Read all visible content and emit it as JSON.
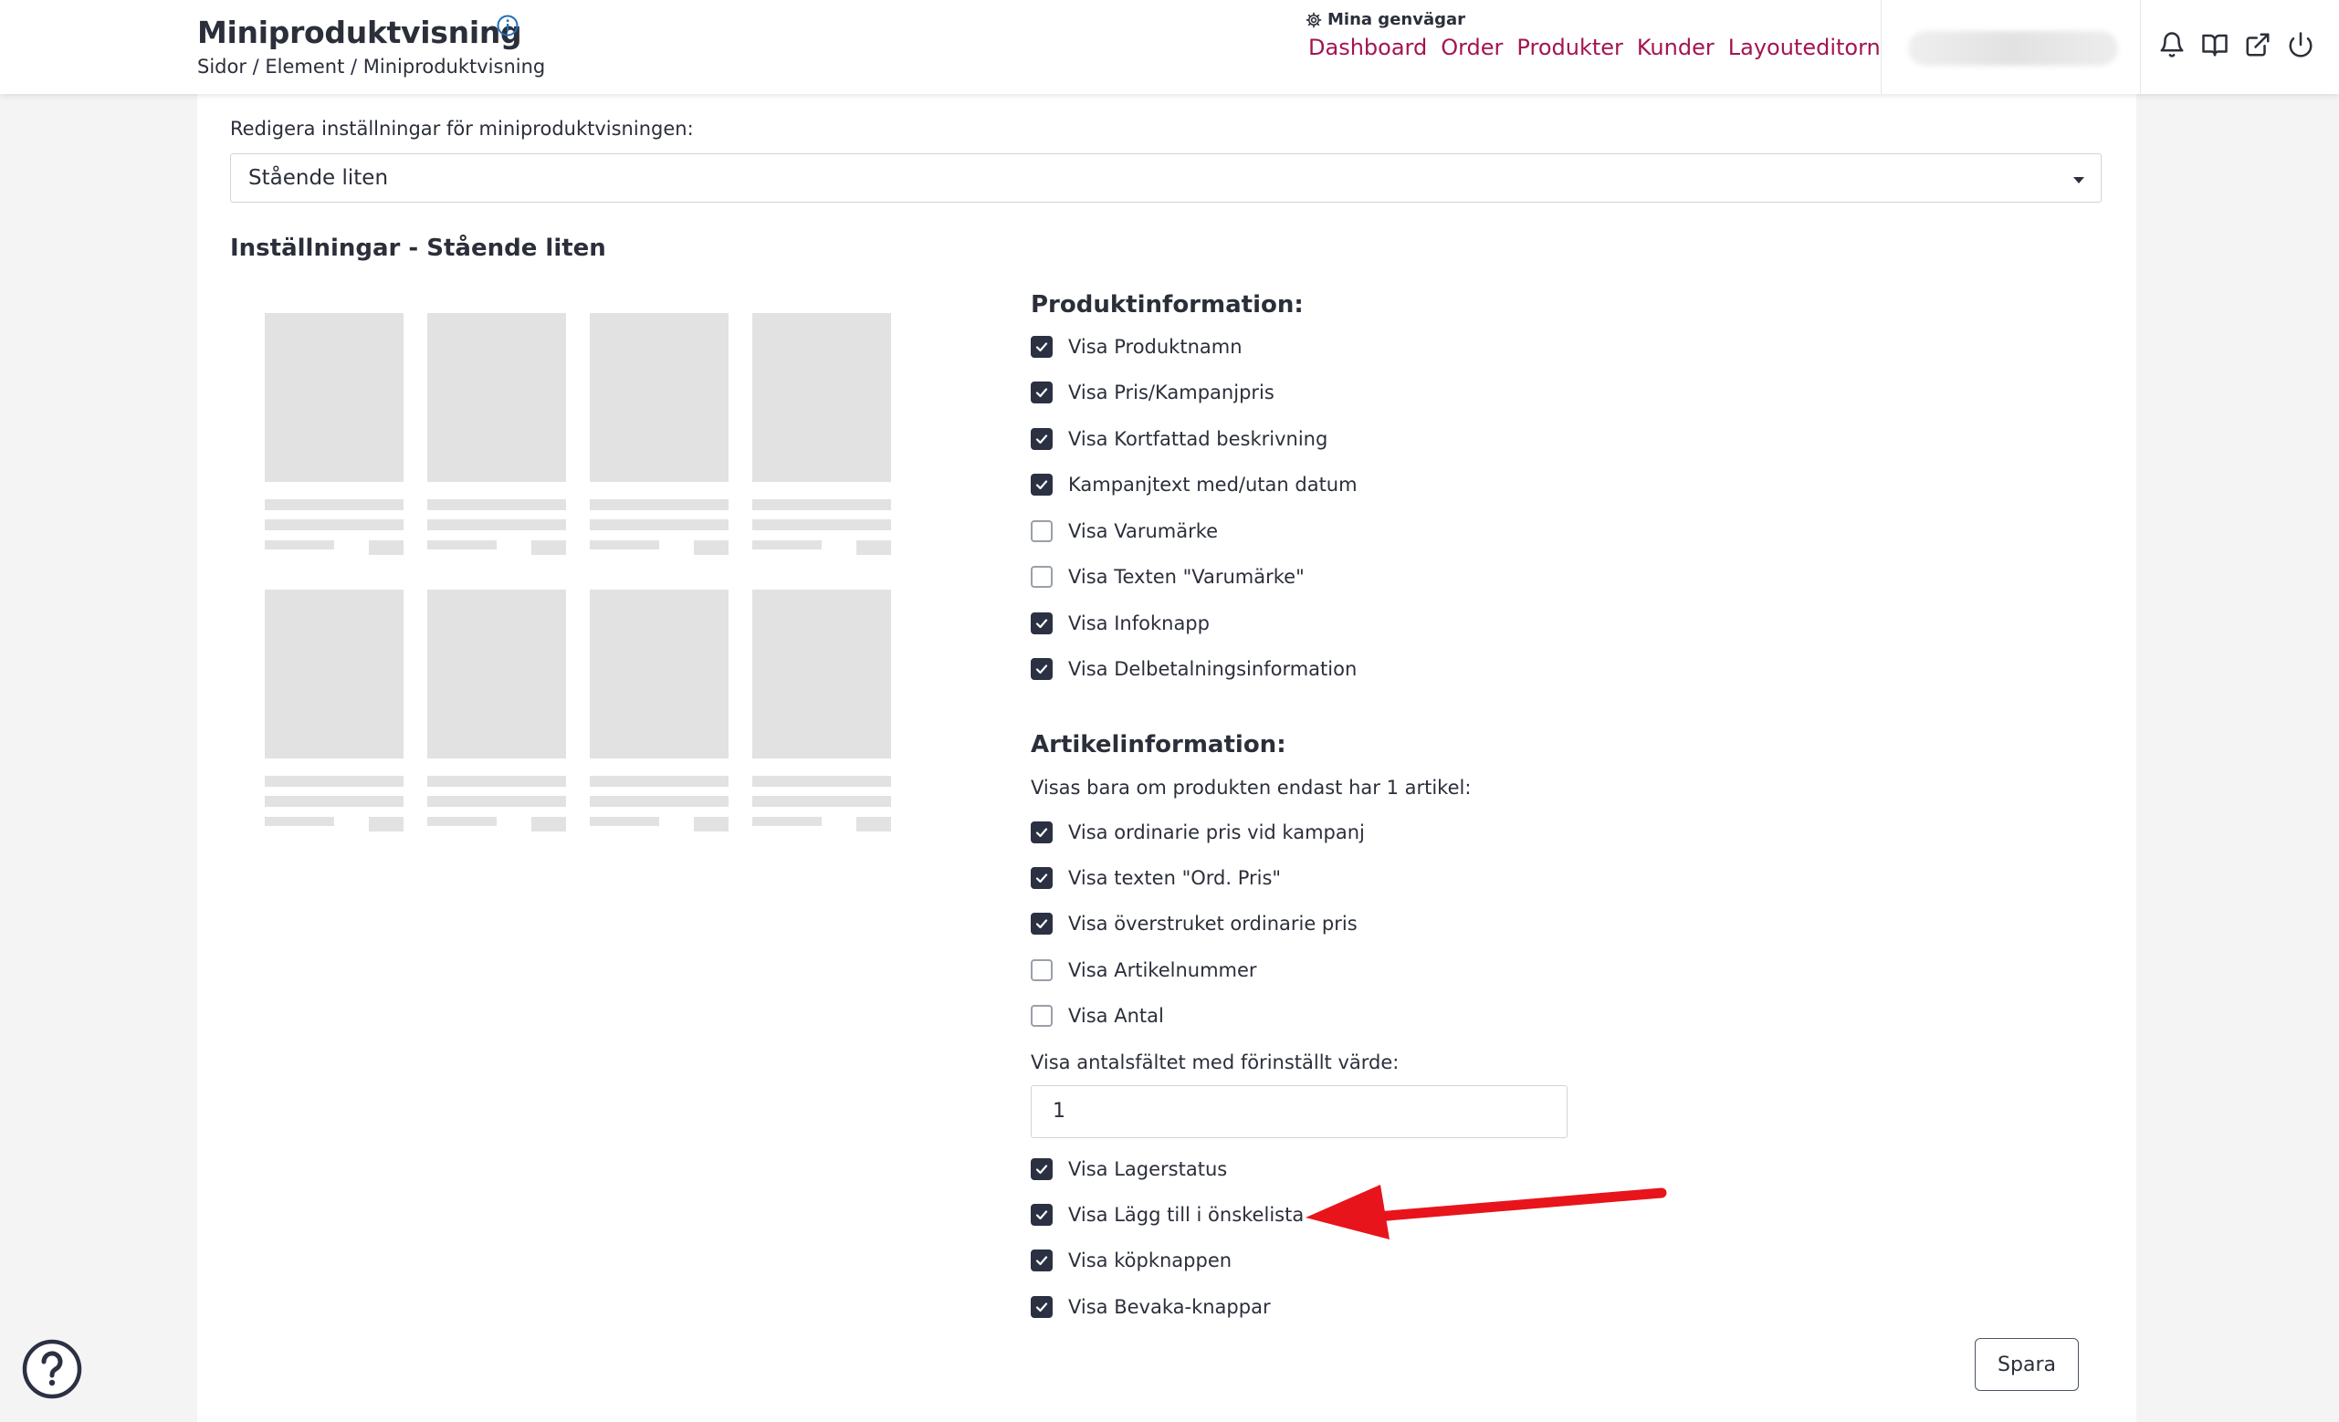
{
  "header": {
    "title": "Miniproduktvisning",
    "breadcrumb": "Sidor / Element / Miniproduktvisning",
    "shortcuts_title": "Mina genvägar",
    "shortcuts": [
      "Dashboard",
      "Order",
      "Produkter",
      "Kunder",
      "Layouteditorn"
    ],
    "icons": [
      "bell-icon",
      "book-icon",
      "external-link-icon",
      "power-icon"
    ]
  },
  "settings_select": {
    "label": "Redigera inställningar för miniproduktvisningen:",
    "value": "Stående liten"
  },
  "settings_title": "Inställningar - Stående liten",
  "product_info": {
    "heading": "Produktinformation:",
    "items": [
      {
        "label": "Visa Produktnamn",
        "checked": true
      },
      {
        "label": "Visa Pris/Kampanjpris",
        "checked": true
      },
      {
        "label": "Visa Kortfattad beskrivning",
        "checked": true
      },
      {
        "label": "Kampanjtext med/utan datum",
        "checked": true
      },
      {
        "label": "Visa Varumärke",
        "checked": false
      },
      {
        "label": "Visa Texten \"Varumärke\"",
        "checked": false
      },
      {
        "label": "Visa Infoknapp",
        "checked": true
      },
      {
        "label": "Visa Delbetalningsinformation",
        "checked": true
      }
    ]
  },
  "article_info": {
    "heading": "Artikelinformation:",
    "note": "Visas bara om produkten endast har 1 artikel:",
    "items": [
      {
        "label": "Visa ordinarie pris vid kampanj",
        "checked": true
      },
      {
        "label": "Visa texten \"Ord. Pris\"",
        "checked": true
      },
      {
        "label": "Visa överstruket ordinarie pris",
        "checked": true
      },
      {
        "label": "Visa Artikelnummer",
        "checked": false
      },
      {
        "label": "Visa Antal",
        "checked": false
      }
    ],
    "quantity_label": "Visa antalsfältet med förinställt värde:",
    "quantity_value": "1",
    "items_after": [
      {
        "label": "Visa Lagerstatus",
        "checked": true
      },
      {
        "label": "Visa Lägg till i önskelista",
        "checked": true
      },
      {
        "label": "Visa köpknappen",
        "checked": true
      },
      {
        "label": "Visa Bevaka-knappar",
        "checked": true
      }
    ]
  },
  "save_label": "Spara",
  "colors": {
    "accent": "#a3154f",
    "checkbox": "#2b3142",
    "annotation_arrow": "#e8141b"
  }
}
